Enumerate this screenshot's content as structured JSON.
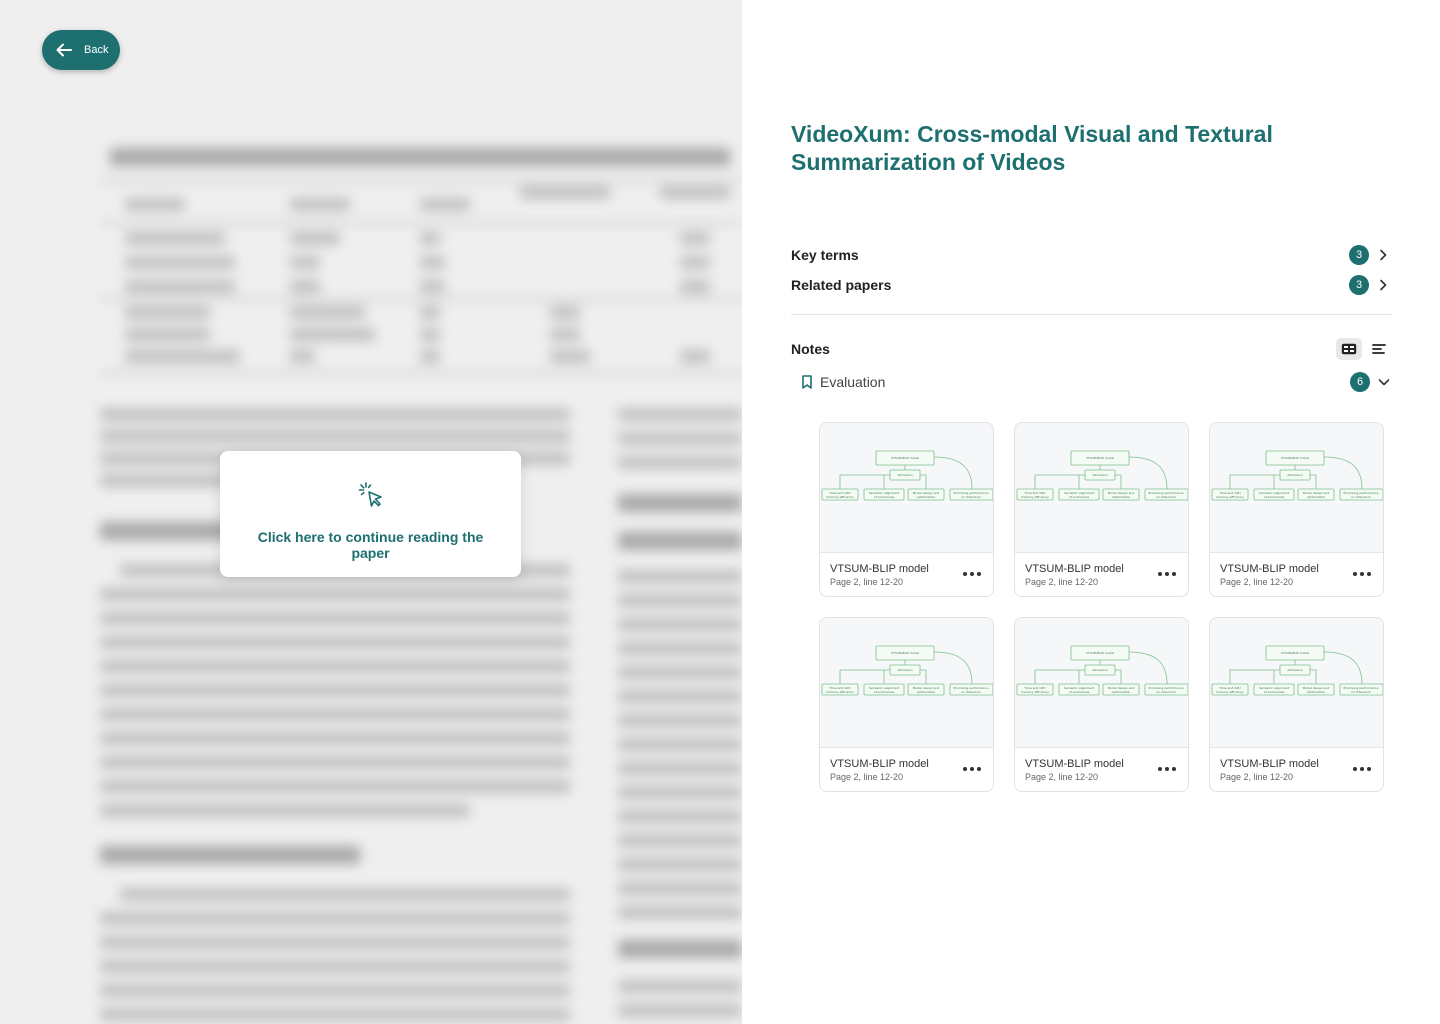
{
  "back": {
    "label": "Back"
  },
  "continue": {
    "text": "Click here to continue reading the paper"
  },
  "paper": {
    "title": "VideoXum: Cross-modal Visual and Textural Summarization of Videos"
  },
  "sections": {
    "key_terms": {
      "label": "Key terms",
      "count": "3"
    },
    "related": {
      "label": "Related papers",
      "count": "3"
    }
  },
  "notes": {
    "label": "Notes",
    "folder": {
      "label": "Evaluation",
      "count": "6"
    },
    "cards": [
      {
        "title": "VTSUM-BLIP model",
        "sub": "Page 2, line 12-20"
      },
      {
        "title": "VTSUM-BLIP model",
        "sub": "Page 2, line 12-20"
      },
      {
        "title": "VTSUM-BLIP model",
        "sub": "Page 2, line 12-20"
      },
      {
        "title": "VTSUM-BLIP model",
        "sub": "Page 2, line 12-20"
      },
      {
        "title": "VTSUM-BLIP model",
        "sub": "Page 2, line 12-20"
      },
      {
        "title": "VTSUM-BLIP model",
        "sub": "Page 2, line 12-20"
      }
    ]
  },
  "colors": {
    "accent": "#1d6f70",
    "diagram": "#7cc08a"
  },
  "icons": [
    "arrow-left-icon",
    "cursor-click-icon",
    "chevron-right-icon",
    "grid-view-icon",
    "list-view-icon",
    "bookmark-icon",
    "chevron-down-icon",
    "more-icon"
  ]
}
